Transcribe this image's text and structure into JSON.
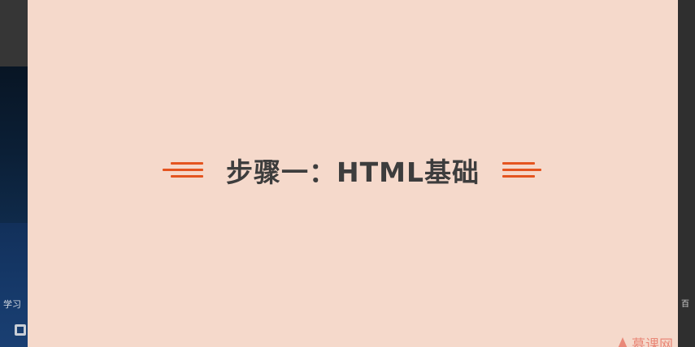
{
  "background_app": {
    "study_label": "学习",
    "right_glyph": "百"
  },
  "slide": {
    "title": "步骤一：HTML基础",
    "accent_color": "#e4541f",
    "background_color": "#f5d9cb",
    "watermark_text": "慕课网",
    "watermark_icon": "flame-icon"
  }
}
